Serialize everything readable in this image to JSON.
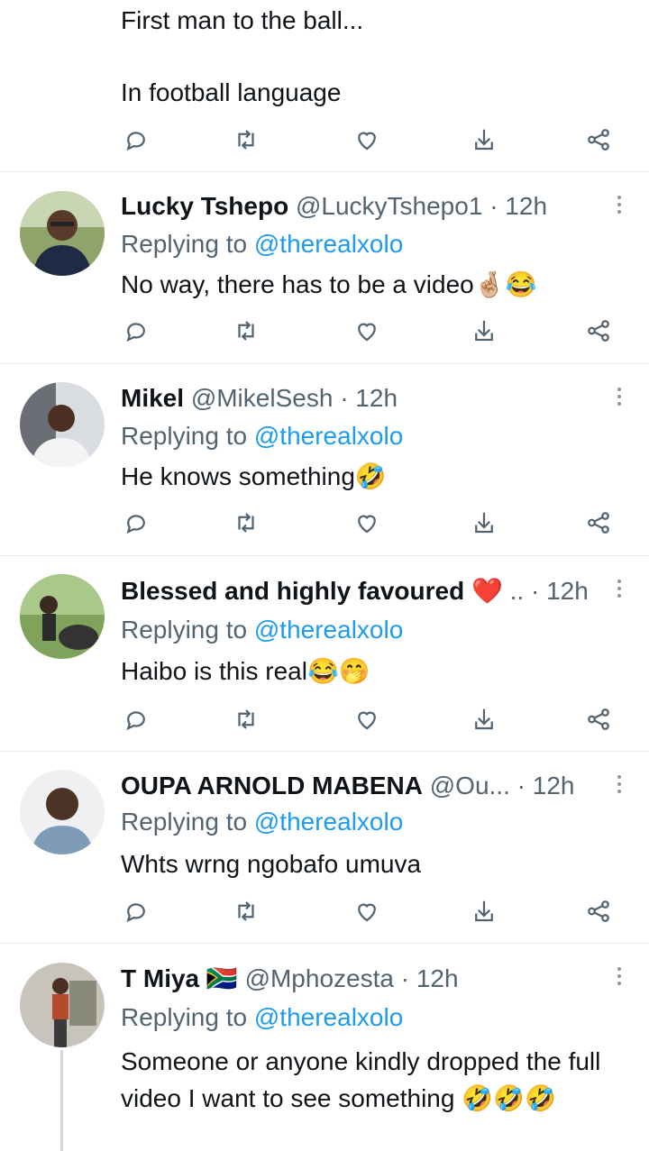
{
  "first": {
    "line1": "First man to the ball...",
    "line2": "In football language"
  },
  "replies": [
    {
      "name": "Lucky Tshepo",
      "handle": "@LuckyTshepo1",
      "time": "12h",
      "replying_prefix": "Replying to",
      "mention": "@therealxolo",
      "text": "No way, there has to be a video🤞🏼😂"
    },
    {
      "name": "Mikel",
      "handle": "@MikelSesh",
      "time": "12h",
      "replying_prefix": "Replying to",
      "mention": "@therealxolo",
      "text": "He knows something🤣"
    },
    {
      "name": "Blessed and highly favoured ❤️",
      "handle": "..",
      "time": "12h",
      "replying_prefix": "Replying to",
      "mention": "@therealxolo",
      "text": "Haibo is this real😂🤭"
    },
    {
      "name": "OUPA ARNOLD MABENA",
      "handle": "@Ou...",
      "time": "12h",
      "replying_prefix": "Replying to",
      "mention": "@therealxolo",
      "text": "Whts wrng ngobafo umuva"
    },
    {
      "name": "T Miya 🇿🇦",
      "handle": "@Mphozesta",
      "time": "12h",
      "replying_prefix": "Replying to",
      "mention": "@therealxolo",
      "text": "Someone or anyone kindly dropped the full video I want to see something 🤣🤣🤣"
    }
  ],
  "icons": [
    "reply-icon",
    "retweet-icon",
    "like-icon",
    "download-icon",
    "share-icon"
  ],
  "colors": {
    "link": "#1d9bf0",
    "muted": "#536471",
    "icon": "#536471"
  }
}
